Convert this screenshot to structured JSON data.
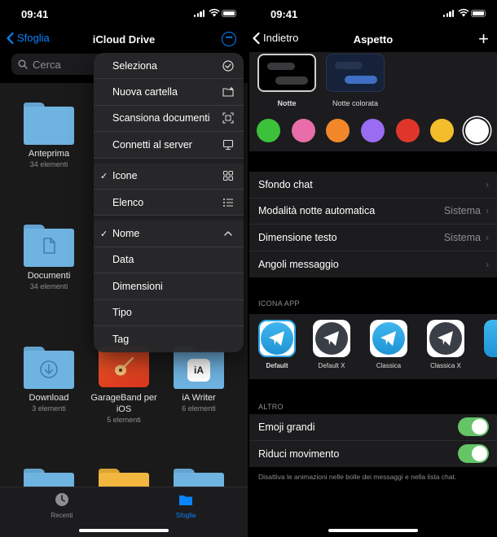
{
  "status": {
    "time": "09:41"
  },
  "files": {
    "back_label": "Sfoglia",
    "title": "iCloud Drive",
    "search_placeholder": "Cerca",
    "items": [
      {
        "name": "Anteprima",
        "meta": "34 elementi"
      },
      {
        "name": "Documenti",
        "meta": "34 elementi"
      },
      {
        "name": "Download",
        "meta": "3 elementi"
      },
      {
        "name": "GarageBand per iOS",
        "meta": "5 elementi"
      },
      {
        "name": "iA Writer",
        "meta": "6 elementi"
      }
    ],
    "menu": {
      "seleziona": "Seleziona",
      "nuova_cartella": "Nuova cartella",
      "scansiona": "Scansiona documenti",
      "connetti": "Connetti al server",
      "icone": "Icone",
      "elenco": "Elenco",
      "nome": "Nome",
      "data": "Data",
      "dimensioni": "Dimensioni",
      "tipo": "Tipo",
      "tag": "Tag"
    },
    "tabs": {
      "recenti": "Recenti",
      "sfoglia": "Sfoglia"
    },
    "ia_glyph": "iA"
  },
  "telegram": {
    "back_label": "Indietro",
    "title": "Aspetto",
    "themes": [
      {
        "label": "Notte"
      },
      {
        "label": "Notte colorata"
      }
    ],
    "swatch_colors": [
      "#3cc13b",
      "#e96da8",
      "#f2872a",
      "#9a6cf2",
      "#e0362a",
      "#f3be2a",
      "#ffffff"
    ],
    "rows": {
      "sfondo_chat": "Sfondo chat",
      "modalita_notte": "Modalità notte automatica",
      "modalita_notte_value": "Sistema",
      "dimensione_testo": "Dimensione testo",
      "dimensione_testo_value": "Sistema",
      "angoli_messaggio": "Angoli messaggio"
    },
    "icona_app_header": "ICONA APP",
    "app_icons": [
      {
        "label": "Default"
      },
      {
        "label": "Default X"
      },
      {
        "label": "Classica"
      },
      {
        "label": "Classica X"
      }
    ],
    "altro_header": "ALTRO",
    "emoji_grandi": "Emoji grandi",
    "riduci_movimento": "Riduci movimento",
    "emoji_grandi_on": true,
    "riduci_movimento_on": true,
    "footer_note": "Disattiva le animazioni nelle bolle dei messaggi e nella lista chat.",
    "colors": {
      "accent": "#0a84ff",
      "toggle_on": "#65c466",
      "telegram_blue": "#2ea6e8"
    }
  }
}
